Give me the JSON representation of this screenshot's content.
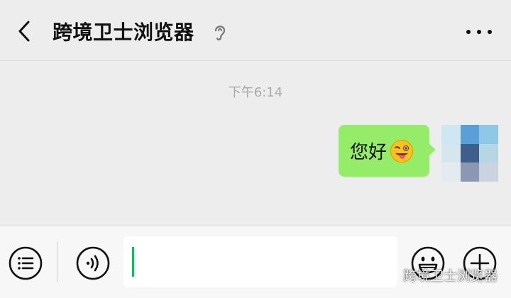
{
  "header": {
    "title": "跨境卫士浏览器",
    "back_icon": "chevron-left-icon",
    "mode_icon": "ear-icon",
    "more_icon": "more-dots-icon"
  },
  "chat": {
    "timestamp": "下午6:14",
    "messages": [
      {
        "sender": "self",
        "text": "您好",
        "emoji": "winking-face-with-tongue"
      }
    ]
  },
  "input_bar": {
    "menu_icon": "list-menu-icon",
    "voice_icon": "voice-icon",
    "emoji_icon": "emoji-icon",
    "plus_icon": "plus-icon",
    "input_value": ""
  },
  "watermark": {
    "text": "跨境卫士浏览器"
  },
  "colors": {
    "background": "#ededed",
    "bubble": "#95ec69",
    "caret": "#07c160",
    "timestamp": "#a8a8a8"
  }
}
